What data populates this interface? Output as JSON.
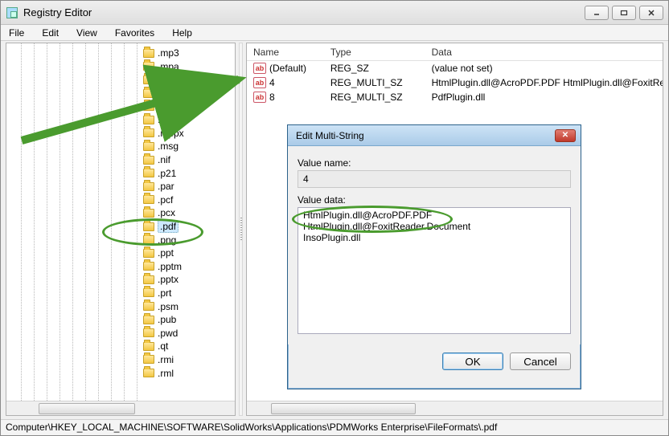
{
  "window": {
    "title": "Registry Editor"
  },
  "menu": {
    "file": "File",
    "edit": "Edit",
    "view": "View",
    "favorites": "Favorites",
    "help": "Help"
  },
  "tree": {
    "items": [
      ".mp3",
      ".mpa",
      ".mpe",
      ".mpeg",
      ".mpg",
      ".mpp",
      ".mppx",
      ".msg",
      ".nif",
      ".p21",
      ".par",
      ".pcf",
      ".pcx",
      ".pdf",
      ".png",
      ".ppt",
      ".pptm",
      ".pptx",
      ".prt",
      ".psm",
      ".pub",
      ".pwd",
      ".qt",
      ".rmi",
      ".rml"
    ],
    "hidden_between_mpeg_mpp": ".mpg",
    "selected_index": 13
  },
  "list": {
    "cols": {
      "name": "Name",
      "type": "Type",
      "data": "Data"
    },
    "col_widths": {
      "name": 96,
      "type": 126,
      "data": 296
    },
    "rows": [
      {
        "name": "(Default)",
        "type": "REG_SZ",
        "data": "(value not set)"
      },
      {
        "name": "4",
        "type": "REG_MULTI_SZ",
        "data": "HtmlPlugin.dll@AcroPDF.PDF HtmlPlugin.dll@FoxitReade..."
      },
      {
        "name": "8",
        "type": "REG_MULTI_SZ",
        "data": "PdfPlugin.dll"
      }
    ]
  },
  "dialog": {
    "title": "Edit Multi-String",
    "value_name_label": "Value name:",
    "value_name": "4",
    "value_data_label": "Value data:",
    "value_data": "HtmlPlugin.dll@AcroPDF.PDF\nHtmlPlugin.dll@FoxitReader.Document\nInsoPlugin.dll\n",
    "ok": "OK",
    "cancel": "Cancel"
  },
  "statusbar": "Computer\\HKEY_LOCAL_MACHINE\\SOFTWARE\\SolidWorks\\Applications\\PDMWorks Enterprise\\FileFormats\\.pdf"
}
